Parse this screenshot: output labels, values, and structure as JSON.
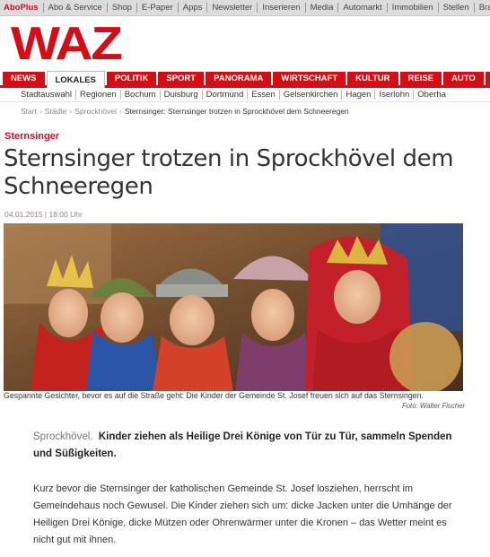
{
  "topbar": {
    "links": [
      "AboPlus",
      "Abo & Service",
      "Shop",
      "E-Paper",
      "Apps",
      "Newsletter",
      "Inserieren",
      "Media",
      "Automarkt",
      "Immobilien",
      "Stellen",
      "Bra"
    ]
  },
  "logo": {
    "text": "WAZ"
  },
  "mainnav": {
    "tabs": [
      "NEWS",
      "LOKALES",
      "POLITIK",
      "SPORT",
      "PANORAMA",
      "WIRTSCHAFT",
      "KULTUR",
      "REISE",
      "AUTO",
      "R"
    ],
    "active": "LOKALES"
  },
  "subnav": {
    "items": [
      "Stadtauswahl",
      "Regionen",
      "Bochum",
      "Duisburg",
      "Dortmund",
      "Essen",
      "Gelsenkirchen",
      "Hagen",
      "Iserlohn",
      "Oberha"
    ]
  },
  "breadcrumb": {
    "items": [
      "Start",
      "Städte",
      "Sprockhövel"
    ],
    "current": "Sternsinger: Sternsinger trotzen in Sprockhövel dem Schneeregen"
  },
  "article": {
    "kicker": "Sternsinger",
    "headline": "Sternsinger trotzen in Sprockhövel dem Schneeregen",
    "date": "04.01.2015 | 18:00 Uhr",
    "caption": "Gespannte Gesichter, bevor es auf die Straße geht: Die Kinder der Gemeinde St. Josef freuen sich auf das Sternsingen.",
    "credit": "Foto: Walter Fischer",
    "location": "Sprockhövel.",
    "teaser": "Kinder ziehen als Heilige Drei Könige von Tür zu Tür, sammeln Spenden und Süßigkeiten.",
    "body": "Kurz bevor die Sternsinger der katholischen Gemeinde St. Josef losziehen, herrscht im Gemeindehaus noch Gewusel. Die Kinder ziehen sich um: dicke Jacken unter die Umhänge der Heiligen Drei Könige, dicke Mützen oder Ohrenwärmer unter die Kronen – das Wetter meint es nicht gut mit ihnen."
  },
  "colors": {
    "brand": "#d40e14",
    "kicker": "#c8102e"
  }
}
